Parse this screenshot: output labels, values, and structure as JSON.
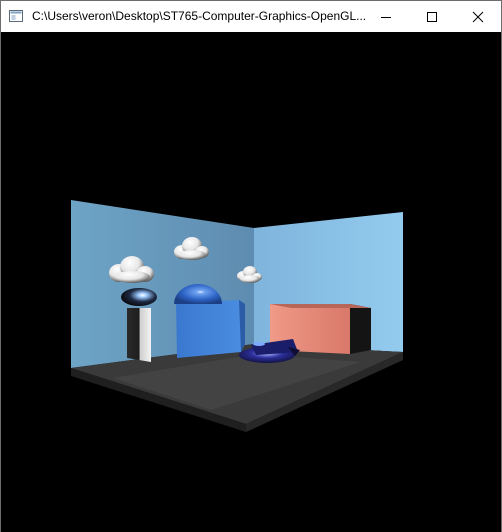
{
  "window": {
    "title": "C:\\Users\\veron\\Desktop\\ST765-Computer-Graphics-OpenGL...",
    "controls": {
      "minimize_icon": "minimize-icon",
      "maximize_icon": "maximize-icon",
      "close_icon": "close-icon"
    }
  },
  "scene": {
    "background_color": "#000000",
    "left_wall_color": "#6ea4c8",
    "right_wall_color": "#8cc4e6",
    "floor_color": "#3b3b3b",
    "pink_box_color": "#e78a7a",
    "blue_box_color": "#3b7fd6",
    "objects": [
      "clouds",
      "pillar",
      "sphere",
      "blue-box",
      "pink-box",
      "airplane",
      "floor"
    ]
  }
}
